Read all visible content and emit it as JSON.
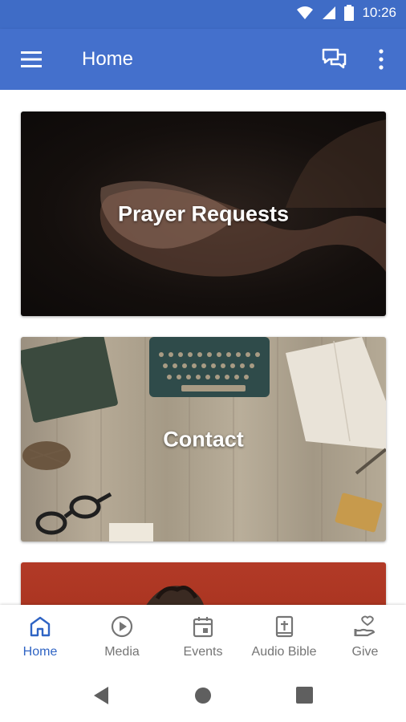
{
  "status_bar": {
    "time": "10:26",
    "icons": [
      "wifi-icon",
      "signal-icon",
      "battery-icon"
    ]
  },
  "app_bar": {
    "title": "Home",
    "menu_icon": "menu-icon",
    "chat_icon": "chat-icon",
    "more_icon": "more-vert-icon"
  },
  "cards": [
    {
      "label": "Prayer Requests"
    },
    {
      "label": "Contact"
    },
    {
      "label": ""
    }
  ],
  "bottom_nav": {
    "items": [
      {
        "label": "Home",
        "icon": "home-icon",
        "active": true
      },
      {
        "label": "Media",
        "icon": "play-icon",
        "active": false
      },
      {
        "label": "Events",
        "icon": "calendar-icon",
        "active": false
      },
      {
        "label": "Audio Bible",
        "icon": "bible-icon",
        "active": false
      },
      {
        "label": "Give",
        "icon": "give-icon",
        "active": false
      }
    ]
  },
  "colors": {
    "primary": "#4470cc",
    "status_bar": "#3f6cc6",
    "active_tab": "#2f64c4",
    "inactive_tab": "#757575"
  }
}
